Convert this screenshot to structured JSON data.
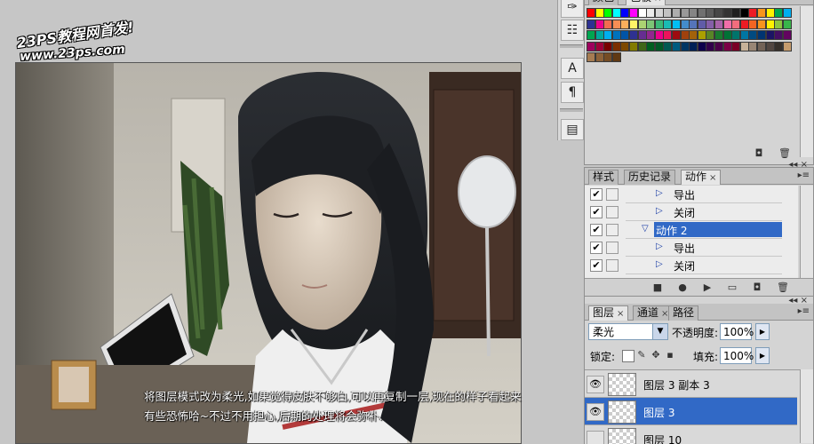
{
  "watermark": {
    "line1": "23PS教程网首发!",
    "line2": "www.23ps.com"
  },
  "caption": {
    "line1": "将图层模式改为柔光,如果觉得皮肤不够白,可以再复制一层,现在的样子看起来",
    "line2": "有些恐怖哈~不过不用担心,后期的处理将会弥补."
  },
  "toolstrip": {
    "icons": [
      "brush-presets-icon",
      "tool-presets-icon",
      "character-icon",
      "paragraph-icon",
      "layer-comps-icon"
    ],
    "glyphs": [
      "✑",
      "☷",
      "A",
      "¶",
      "▤"
    ]
  },
  "swatches_panel": {
    "tabs": [
      "颜色",
      "色板"
    ],
    "colors": [
      "#ff0000",
      "#ffff00",
      "#00ff00",
      "#00ffff",
      "#0000ff",
      "#ff00ff",
      "#ffffff",
      "#ebebeb",
      "#d6d6d6",
      "#c2c2c2",
      "#adadad",
      "#999999",
      "#858585",
      "#707070",
      "#5c5c5c",
      "#474747",
      "#333333",
      "#1f1f1f",
      "#000000",
      "#ed1c24",
      "#f7941d",
      "#fff200",
      "#00a651",
      "#00aeef",
      "#2e3192",
      "#ec008c",
      "#f26c4f",
      "#f68e55",
      "#fbaf5c",
      "#fff467",
      "#acd372",
      "#7cc576",
      "#3bb878",
      "#1abbb4",
      "#00bff3",
      "#438ccb",
      "#5574b9",
      "#605ca8",
      "#855fa8",
      "#a763a8",
      "#f06ea9",
      "#f26d7d",
      "#ed1c24",
      "#f26522",
      "#f7941d",
      "#fff200",
      "#8dc63f",
      "#39b54a",
      "#00a651",
      "#00a99d",
      "#00aeef",
      "#0072bc",
      "#0054a6",
      "#2e3192",
      "#662d91",
      "#92278f",
      "#ec008c",
      "#ed145b",
      "#9e0b0f",
      "#a0410d",
      "#a3620a",
      "#aba000",
      "#598527",
      "#197b30",
      "#007236",
      "#00746b",
      "#0076a3",
      "#004a80",
      "#003471",
      "#1b1464",
      "#440e62",
      "#630460",
      "#9e005d",
      "#9e0039",
      "#790000",
      "#7b2e00",
      "#7d4900",
      "#827b00",
      "#406618",
      "#005e20",
      "#005826",
      "#005952",
      "#005b7f",
      "#003663",
      "#002157",
      "#0d004c",
      "#32004b",
      "#4b0049",
      "#7b0046",
      "#7a0026",
      "#c7b299",
      "#998675",
      "#736357",
      "#534741",
      "#37302a",
      "#c69c6d",
      "#a67c52",
      "#8c6239",
      "#754c24",
      "#603913"
    ],
    "buttons": [
      "new-swatch-icon",
      "delete-swatch-icon"
    ]
  },
  "actions_panel": {
    "tabs": [
      "样式",
      "历史记录",
      "动作"
    ],
    "rows": [
      {
        "label": "导出",
        "indent": 2,
        "selected": false,
        "expanded": false
      },
      {
        "label": "关闭",
        "indent": 2,
        "selected": false,
        "expanded": false
      },
      {
        "label": "动作 2",
        "indent": 1,
        "selected": true,
        "expanded": true
      },
      {
        "label": "导出",
        "indent": 2,
        "selected": false,
        "expanded": false
      },
      {
        "label": "关闭",
        "indent": 2,
        "selected": false,
        "expanded": false
      }
    ],
    "buttons": [
      "stop-icon",
      "record-icon",
      "play-icon",
      "new-set-icon",
      "new-action-icon",
      "delete-action-icon"
    ]
  },
  "layers_panel": {
    "tabs": [
      "图层",
      "通道",
      "路径"
    ],
    "blend_mode": "柔光",
    "opacity_label": "不透明度:",
    "opacity": "100%",
    "lock_label": "锁定:",
    "fill_label": "填充:",
    "fill": "100%",
    "layers": [
      {
        "name": "图层 3 副本 3",
        "visible": true,
        "selected": false
      },
      {
        "name": "图层 3",
        "visible": true,
        "selected": true
      },
      {
        "name": "图层 10",
        "visible": false,
        "selected": false
      }
    ]
  }
}
